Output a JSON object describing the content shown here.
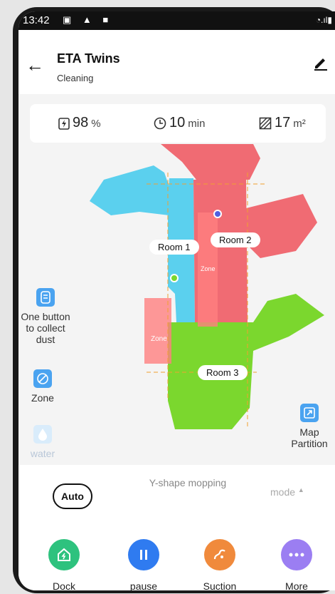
{
  "status_bar": {
    "time": "13:42"
  },
  "header": {
    "title": "ETA Twins",
    "subtitle": "Cleaning"
  },
  "stats": {
    "battery_value": "98",
    "battery_unit": "%",
    "time_value": "10",
    "time_unit": "min",
    "area_value": "17",
    "area_unit": "m²"
  },
  "side_tools": {
    "collect_dust_label": "One button to collect dust",
    "zone_label": "Zone",
    "water_label": "water",
    "map_partition_label": "Map Partition"
  },
  "map": {
    "rooms": [
      "Room 1",
      "Room 2",
      "Room 3"
    ],
    "zone_labels": [
      "Zone",
      "Zone"
    ],
    "colors": {
      "room1": "#5bd0ee",
      "room2": "#f06b73",
      "room3": "#7bd72e",
      "zone": "#ff8080"
    }
  },
  "modes": {
    "auto": "Auto",
    "yshape": "Y-shape mopping",
    "mode": "mode"
  },
  "actions": [
    {
      "label": "Dock",
      "color": "#2ec27e"
    },
    {
      "label": "pause",
      "color": "#2f7bf0"
    },
    {
      "label": "Suction",
      "color": "#f08a3c"
    },
    {
      "label": "More",
      "color": "#9b7ef2"
    }
  ]
}
